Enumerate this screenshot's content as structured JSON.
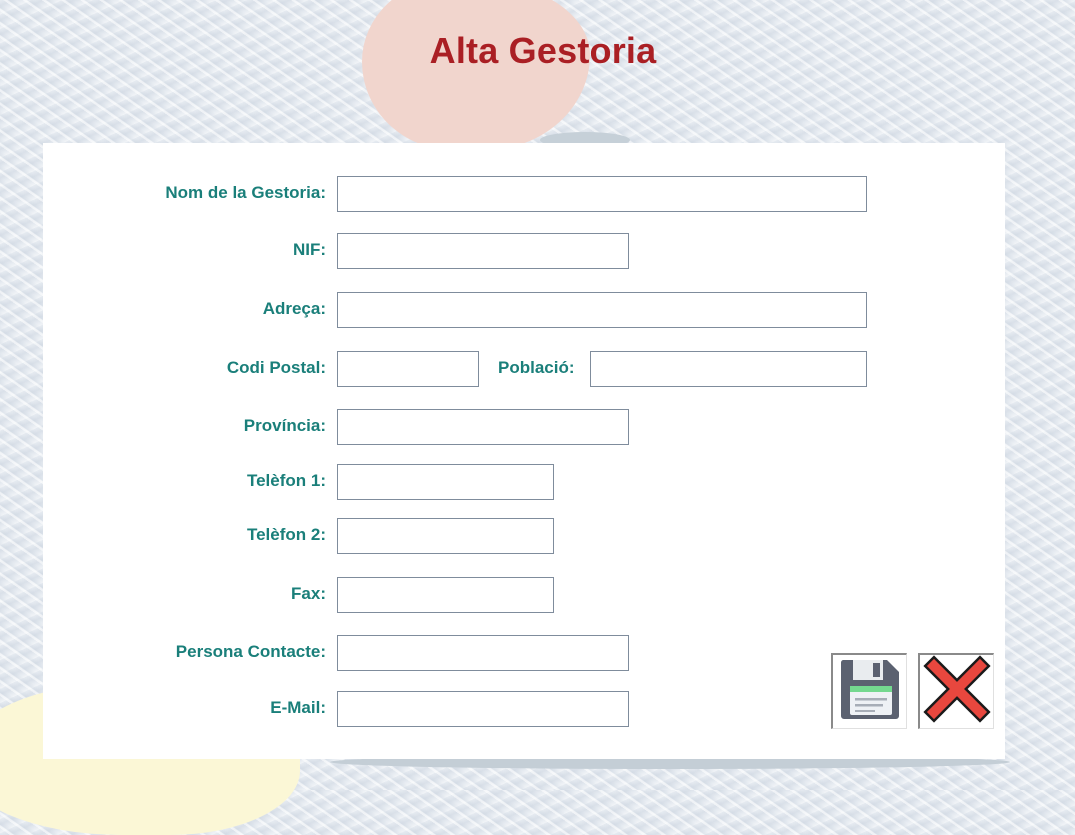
{
  "page": {
    "title": "Alta Gestoria"
  },
  "form": {
    "fields": {
      "nom": {
        "label": "Nom de la Gestoria:",
        "value": ""
      },
      "nif": {
        "label": "NIF:",
        "value": ""
      },
      "adreca": {
        "label": "Adreça:",
        "value": ""
      },
      "codi_postal": {
        "label": "Codi Postal:",
        "value": ""
      },
      "poblacio": {
        "label": "Població:",
        "value": ""
      },
      "provincia": {
        "label": "Província:",
        "value": ""
      },
      "telefon1": {
        "label": "Telèfon 1:",
        "value": ""
      },
      "telefon2": {
        "label": "Telèfon 2:",
        "value": ""
      },
      "fax": {
        "label": "Fax:",
        "value": ""
      },
      "persona_contacte": {
        "label": "Persona Contacte:",
        "value": ""
      },
      "email": {
        "label": "E-Mail:",
        "value": ""
      }
    }
  },
  "actions": {
    "save_icon": "floppy-disk-icon",
    "cancel_icon": "red-x-icon"
  },
  "colors": {
    "title": "#aa1f24",
    "label": "#1a7f7a",
    "field_border": "#7f8c9c",
    "panel": "#ffffff",
    "background": "#e6ebf1"
  }
}
